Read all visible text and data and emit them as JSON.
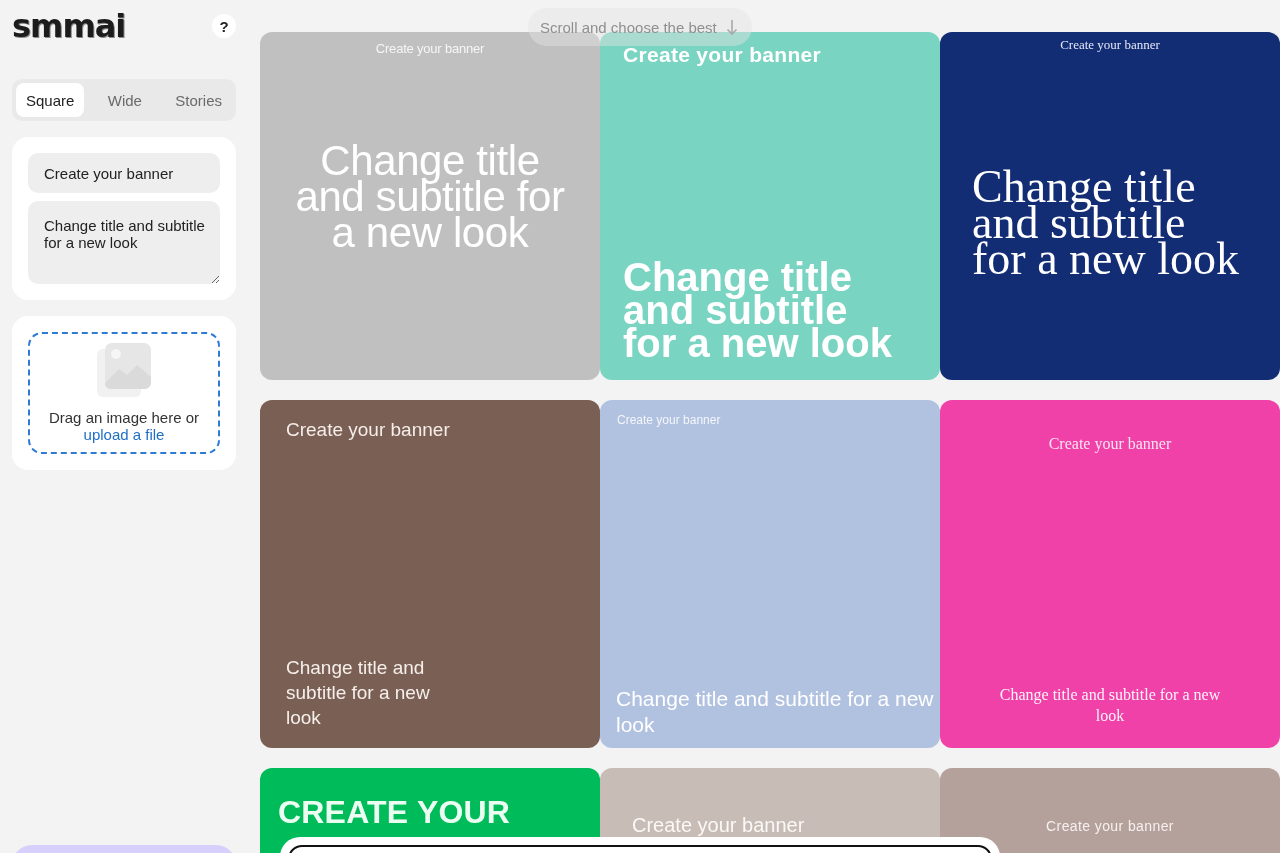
{
  "logo": "smmai",
  "help_button": "?",
  "format_tabs": [
    {
      "label": "Square",
      "selected": true
    },
    {
      "label": "Wide",
      "selected": false
    },
    {
      "label": "Stories",
      "selected": false
    }
  ],
  "title_field": {
    "value": "Create your banner"
  },
  "subtitle_field": {
    "value": "Change title and subtitle for a new look"
  },
  "upload": {
    "prompt": "Drag an image here or",
    "link": "upload a file"
  },
  "scroll_hint": "Scroll and choose the best",
  "banners": [
    {
      "kind": "centered",
      "color": "#c0c0c0",
      "title": "Create your banner",
      "subtitle": "Change title and subtitle for a new look"
    },
    {
      "kind": "heavy",
      "color": "#7ad4c2",
      "title": "Create your banner",
      "subtitle": "Change title and subtitle for a new look"
    },
    {
      "kind": "serif",
      "color": "#132d75",
      "title": "Create your banner",
      "subtitle": "Change title and subtitle for a new look"
    },
    {
      "kind": "narrow",
      "color": "#7a5f55",
      "title": "Create your banner",
      "subtitle": "Change title and subtitle for a new look"
    },
    {
      "kind": "light",
      "color": "#b1c1e0",
      "title": "Create your banner",
      "subtitle": "Change title and subtitle for a new look"
    },
    {
      "kind": "serifcenter",
      "color": "#ef41a8",
      "title": "Create your banner",
      "subtitle": "Change title and subtitle for a new look"
    },
    {
      "kind": "display",
      "color": "#00bb5a",
      "title": "CREATE YOUR"
    },
    {
      "kind": "condensed",
      "color": "#c8bcb7",
      "title": "Create your banner"
    },
    {
      "kind": "lightcenter",
      "color": "#b5a19b",
      "title": "Create your banner"
    }
  ]
}
